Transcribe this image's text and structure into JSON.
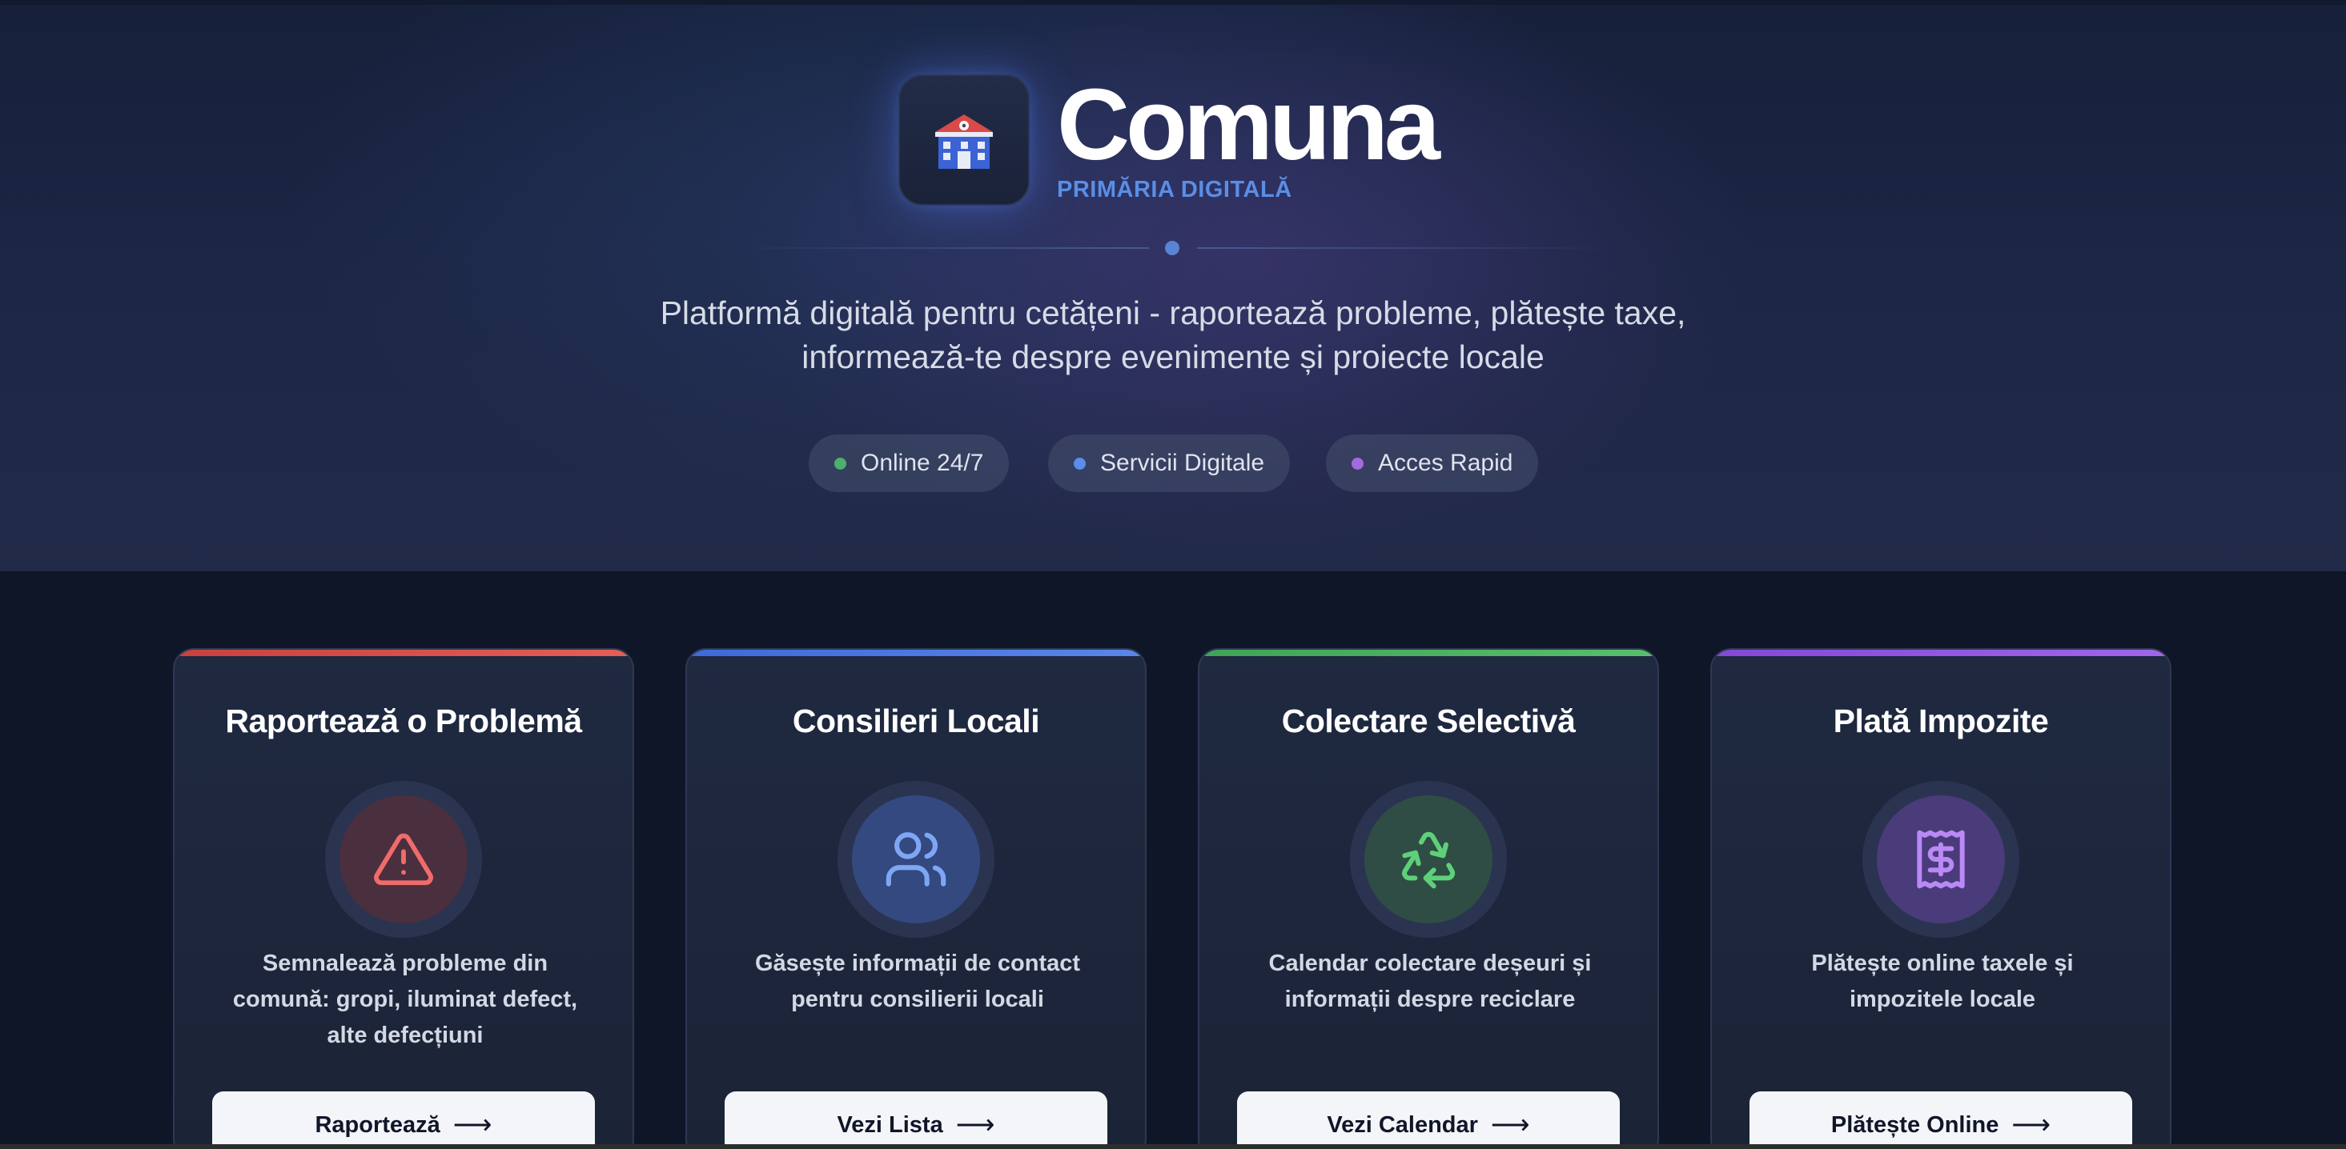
{
  "brand": {
    "title": "Comuna",
    "subtitle": "PRIMĂRIA DIGITALĂ",
    "logo_icon": "town-hall-icon"
  },
  "hero": {
    "tagline_line1": "Platformă digitală pentru cetățeni - raportează probleme, plătește taxe,",
    "tagline_line2": "informează-te despre evenimente și proiecte locale"
  },
  "badges": [
    {
      "label": "Online 24/7",
      "color": "#4caf6e"
    },
    {
      "label": "Servicii Digitale",
      "color": "#5b8def"
    },
    {
      "label": "Acces Rapid",
      "color": "#a36be0"
    }
  ],
  "cards": [
    {
      "title": "Raportează o Problemă",
      "icon": "warning-triangle-icon",
      "accent": "#e0524f",
      "desc_lines": [
        "Semnalează probleme din",
        "comună: gropi, iluminat defect,",
        "alte defecțiuni"
      ],
      "button": "Raportează"
    },
    {
      "title": "Consilieri Locali",
      "icon": "users-icon",
      "accent": "#4a78e0",
      "desc_lines": [
        "Găsește informații de contact",
        "pentru consilierii locali"
      ],
      "button": "Vezi Lista"
    },
    {
      "title": "Colectare Selectivă",
      "icon": "recycle-icon",
      "accent": "#47b45c",
      "desc_lines": [
        "Calendar colectare deșeuri și",
        "informații despre reciclare"
      ],
      "button": "Vezi Calendar"
    },
    {
      "title": "Plată Impozite",
      "icon": "receipt-dollar-icon",
      "accent": "#8f52e0",
      "desc_lines": [
        "Plătește online taxele și",
        "impozitele locale"
      ],
      "button": "Plătește Online"
    }
  ],
  "button_arrow": "⟶"
}
